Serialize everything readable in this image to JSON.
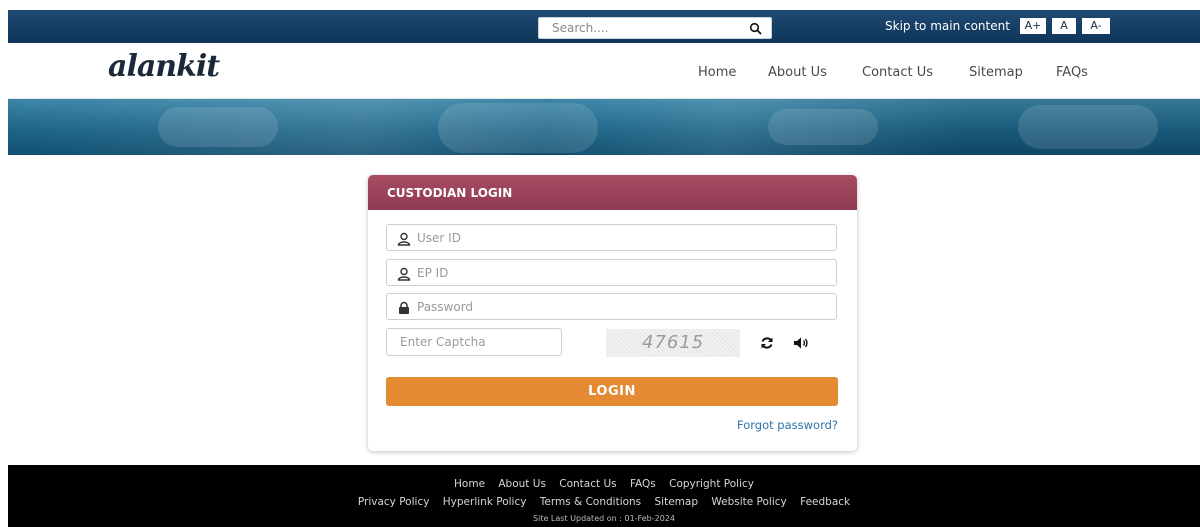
{
  "topbar": {
    "search_placeholder": "Search....",
    "skip_link": "Skip to main content",
    "font_buttons": [
      "A+",
      "A",
      "A-"
    ]
  },
  "header": {
    "logo": "alankit",
    "nav": [
      "Home",
      "About Us",
      "Contact Us",
      "Sitemap",
      "FAQs"
    ]
  },
  "login": {
    "title": "CUSTODIAN LOGIN",
    "userid_placeholder": "User ID",
    "epid_placeholder": "EP ID",
    "password_placeholder": "Password",
    "captcha_placeholder": "Enter Captcha",
    "captcha_code": "47615",
    "button_label": "LOGIN",
    "forgot_label": "Forgot password?"
  },
  "footer": {
    "row1": [
      "Home",
      "About Us",
      "Contact Us",
      "FAQs",
      "Copyright Policy"
    ],
    "row2": [
      "Privacy Policy",
      "Hyperlink Policy",
      "Terms & Conditions",
      "Sitemap",
      "Website Policy",
      "Feedback"
    ],
    "updated": "Site Last Updated on : 01-Feb-2024"
  },
  "colors": {
    "topbar": "#0f3559",
    "card_header": "#8e3a52",
    "login_button": "#e38a33",
    "link": "#2d74a8",
    "footer": "#000000"
  },
  "icons": [
    "search-icon",
    "user-icon",
    "lock-icon",
    "refresh-icon",
    "speaker-icon"
  ]
}
